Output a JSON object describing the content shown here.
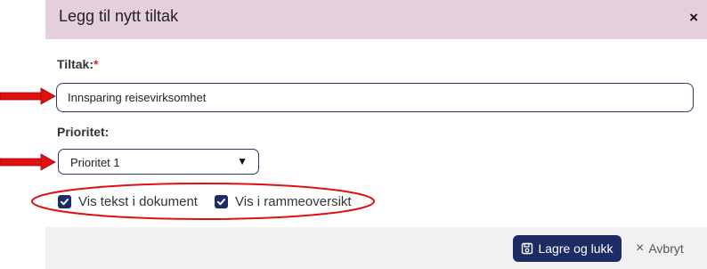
{
  "dialog": {
    "title": "Legg til nytt tiltak",
    "close_icon": "×"
  },
  "form": {
    "tiltak_label": "Tiltak:",
    "required_mark": "*",
    "tiltak_value": "Innsparing reisevirksomhet",
    "prioritet_label": "Prioritet:",
    "prioritet_value": "Prioritet 1",
    "caret_icon": "▼",
    "checkboxes": [
      {
        "label": "Vis tekst i dokument",
        "checked": true
      },
      {
        "label": "Vis i rammeoversikt",
        "checked": true
      }
    ]
  },
  "footer": {
    "save_label": "Lagre og lukk",
    "cancel_icon": "×",
    "cancel_label": "Avbryt"
  },
  "colors": {
    "header_bg": "#e6cfdc",
    "primary": "#1e2c66",
    "required": "#d9282f",
    "annotation": "#e01010"
  },
  "icons": {
    "save": "floppy-disk-icon",
    "check": "check-icon"
  }
}
